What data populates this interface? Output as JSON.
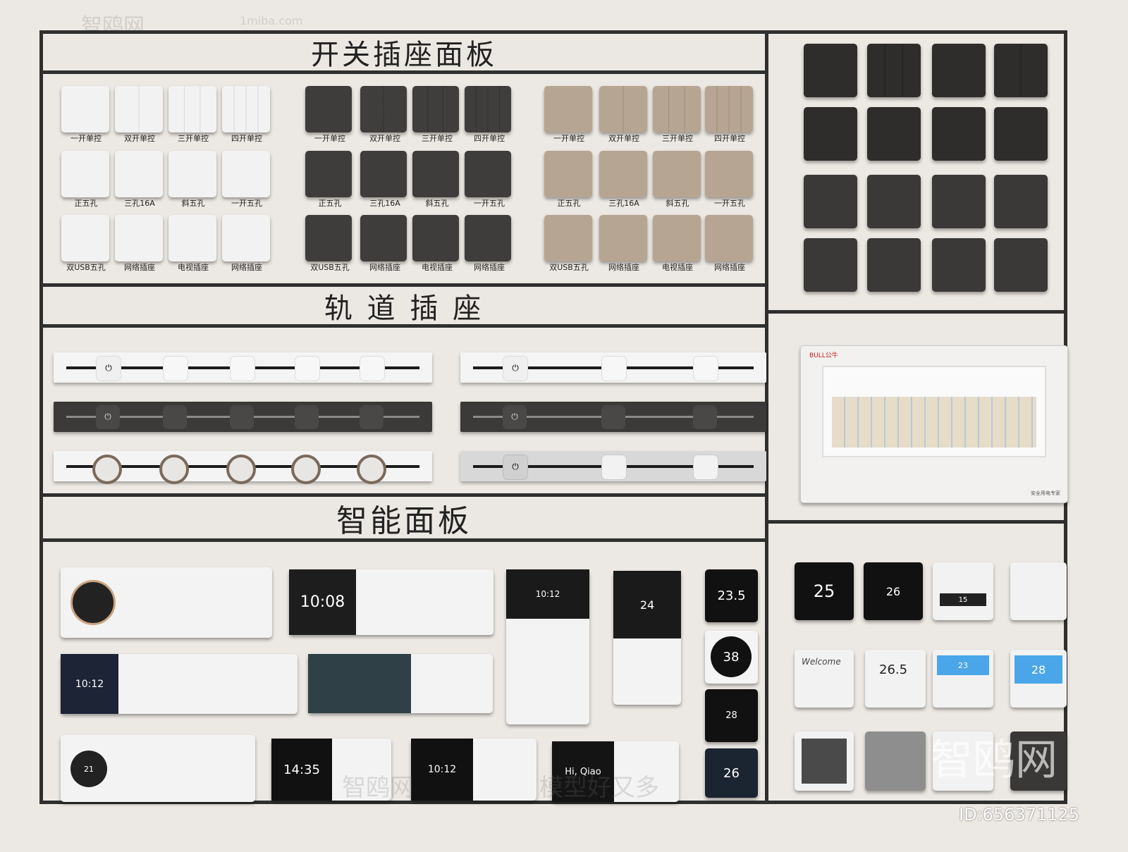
{
  "sections": {
    "switch_panels": "开关插座面板",
    "track_sockets": "轨 道 插 座",
    "smart_panels": "智能面板"
  },
  "switch_labels": {
    "row1": [
      "一开单控",
      "双开单控",
      "三开单控",
      "四开单控"
    ],
    "row2": [
      "正五孔",
      "三孔16A",
      "斜五孔",
      "一开五孔"
    ],
    "row3": [
      "双USB五孔",
      "网络插座",
      "电视插座",
      "网络插座"
    ]
  },
  "screens": {
    "time_1008": "10:08",
    "time_1012_a": "10:12",
    "time_1012_b": "10:12",
    "time_1012_c": "10:12",
    "time_1435": "14:35",
    "greeting": "Hi, Qiao",
    "thermostat_target": "24",
    "temp_235": "23.5",
    "humidity_38": "38",
    "temp_28": "28",
    "temp_26": "26",
    "temp_25": "25",
    "temp_26b": "26",
    "temp_15": "15",
    "temp_265": "26.5",
    "temp_23": "23",
    "temp_28b": "28",
    "dial_21": "21",
    "welcome": "Welcome"
  },
  "breaker_box": {
    "brand": "BULL公牛",
    "caption": "安全用电专家"
  },
  "watermarks": {
    "site": "智鸥网",
    "slogan": "模型好又多",
    "domain": "1miba.com",
    "big": "智鸥网"
  },
  "image_id": "ID:656371125",
  "colors": {
    "white_panel": "#efefef",
    "dark_panel": "#403e3c",
    "tan_panel": "#b6a592",
    "frame": "#2f2f2f"
  }
}
